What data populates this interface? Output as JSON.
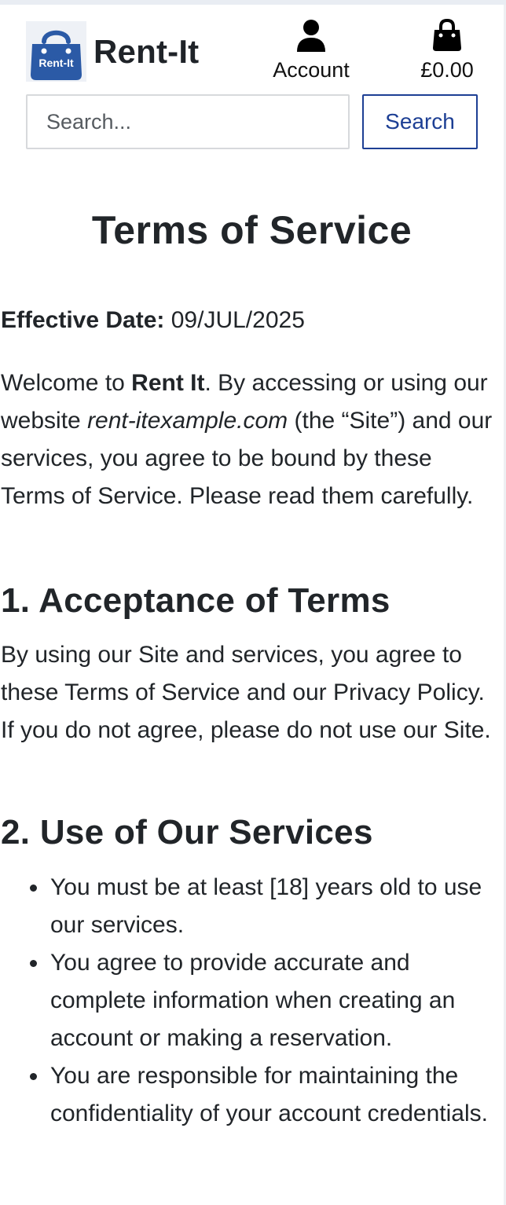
{
  "header": {
    "brand_name": "Rent-It",
    "logo_badge_text": "Rent-It",
    "account_label": "Account",
    "cart_total": "£0.00"
  },
  "search": {
    "placeholder": "Search...",
    "button_label": "Search"
  },
  "page": {
    "title": "Terms of Service",
    "effective_label": "Effective Date:",
    "effective_value": "09/JUL/2025",
    "intro": {
      "before_name": "Welcome to ",
      "company": "Rent It",
      "after_name": ". By accessing or using our website ",
      "site_url": "rent-itexample.com",
      "after_url": " (the “Site”) and our services, you agree to be bound by these Terms of Service. Please read them carefully."
    },
    "sections": [
      {
        "heading": "1. Acceptance of Terms",
        "text": "By using our Site and services, you agree to these Terms of Service and our Privacy Policy. If you do not agree, please do not use our Site."
      },
      {
        "heading": "2. Use of Our Services",
        "bullets": [
          "You must be at least [18] years old to use our services.",
          "You agree to provide accurate and complete information when creating an account or making a reservation.",
          "You are responsible for maintaining the confidentiality of your account credentials."
        ]
      }
    ]
  },
  "colors": {
    "accent": "#1d3f94",
    "logo_blue": "#2b5aa6",
    "text": "#212529"
  },
  "icons": {
    "logo": "shopping-bag-logo-icon",
    "account": "user-icon",
    "cart": "shopping-bag-icon"
  }
}
